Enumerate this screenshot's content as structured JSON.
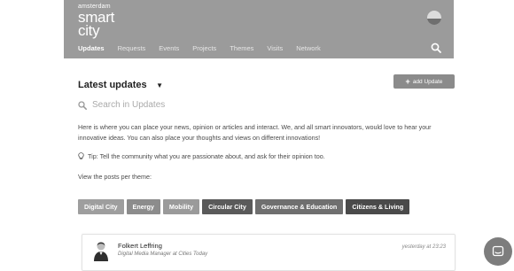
{
  "header": {
    "logo_city": "amsterdam",
    "logo_line1": "smart",
    "logo_line2": "city",
    "nav": [
      "Updates",
      "Requests",
      "Events",
      "Projects",
      "Themes",
      "Visits",
      "Network"
    ],
    "active_nav": "Updates"
  },
  "main": {
    "title": "Latest updates",
    "caret": "▼",
    "add_button": {
      "plus": "+",
      "label": "add Update"
    },
    "search_placeholder": "Search in Updates",
    "description": "Here is where you can place your news, opinion or articles and interact. We, and all smart innovators, would love to hear your innovative ideas. You can also place your thoughts and views on different innovations!",
    "tip": "Tip: Tell the community what you are passionate about, and ask for their opinion too.",
    "view_posts_label": "View the posts per theme:"
  },
  "themes": [
    {
      "label": "Digital City",
      "color": "#9e9e9e"
    },
    {
      "label": "Energy",
      "color": "#8c8c8c"
    },
    {
      "label": "Mobility",
      "color": "#9a9a9a"
    },
    {
      "label": "Circular City",
      "color": "#5a5a5a"
    },
    {
      "label": "Governance & Education",
      "color": "#6f6f6f"
    },
    {
      "label": "Citizens & Living",
      "color": "#4a4a4a"
    }
  ],
  "post": {
    "author": "Folkert Leffring",
    "role": "Digital Media Manager at Cities Today",
    "time": "yesterday at 23:23"
  },
  "colors": {
    "header_bg": "#9b9b9b",
    "button_bg": "#8b8b8b",
    "chat_bg": "#7d7d7d"
  }
}
